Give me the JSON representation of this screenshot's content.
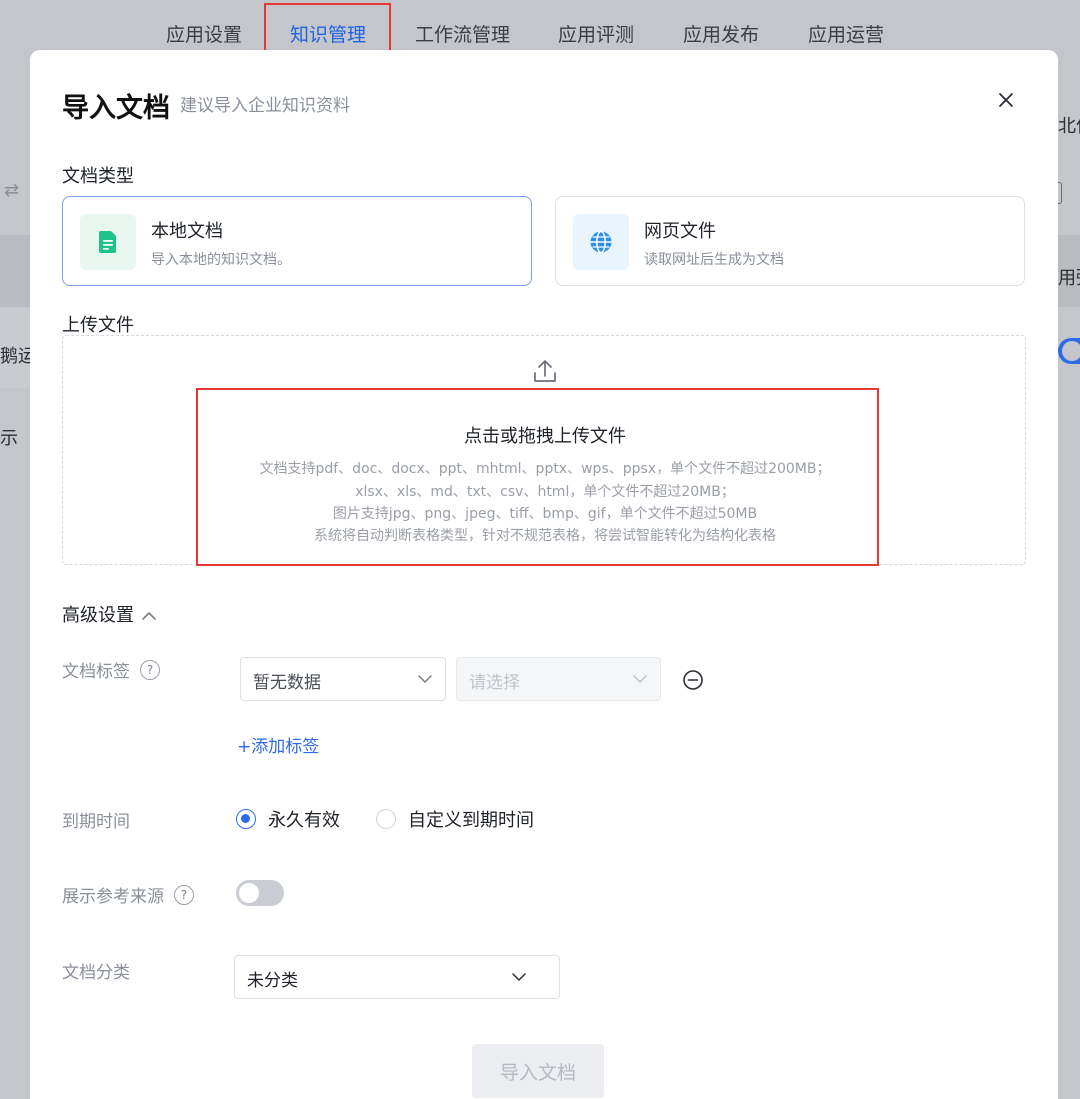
{
  "nav": {
    "tabs": [
      {
        "label": "应用设置",
        "active": false
      },
      {
        "label": "知识管理",
        "active": true
      },
      {
        "label": "工作流管理",
        "active": false
      },
      {
        "label": "应用评测",
        "active": false
      },
      {
        "label": "应用发布",
        "active": false
      },
      {
        "label": "应用运营",
        "active": false
      }
    ]
  },
  "background": {
    "right_fragment_1": "北亿",
    "right_fragment_2": "用粥",
    "left_fragment_1": "鹅运",
    "left_fragment_2": "示",
    "left_swap_glyph": "⇄"
  },
  "modal": {
    "title": "导入文档",
    "subtitle": "建议导入企业知识资料",
    "doc_type_label": "文档类型",
    "doc_types": [
      {
        "name": "本地文档",
        "desc": "导入本地的知识文档。",
        "selected": true,
        "icon": "file-icon"
      },
      {
        "name": "网页文件",
        "desc": "读取网址后生成为文档",
        "selected": false,
        "icon": "globe-icon"
      }
    ],
    "upload_label": "上传文件",
    "upload": {
      "title": "点击或拖拽上传文件",
      "lines": [
        "文档支持pdf、doc、docx、ppt、mhtml、pptx、wps、ppsx，单个文件不超过200MB；",
        "xlsx、xls、md、txt、csv、html，单个文件不超过20MB；",
        "图片支持jpg、png、jpeg、tiff、bmp、gif，单个文件不超过50MB",
        "系统将自动判断表格类型，针对不规范表格，将尝试智能转化为结构化表格"
      ]
    },
    "advanced": {
      "label": "高级设置",
      "expanded": true,
      "tag": {
        "label": "文档标签",
        "select_value": "暂无数据",
        "select2_placeholder": "请选择",
        "add_label": "+添加标签"
      },
      "expiry": {
        "label": "到期时间",
        "options": [
          "永久有效",
          "自定义到期时间"
        ],
        "selected": 0
      },
      "show_source": {
        "label": "展示参考来源",
        "enabled": false
      },
      "category": {
        "label": "文档分类",
        "value": "未分类"
      }
    },
    "submit_label": "导入文档"
  },
  "colors": {
    "accent": "#2f6be8",
    "highlight_box": "#e53935",
    "file_icon": "#1ec28b",
    "globe_icon": "#2e8fe8"
  }
}
